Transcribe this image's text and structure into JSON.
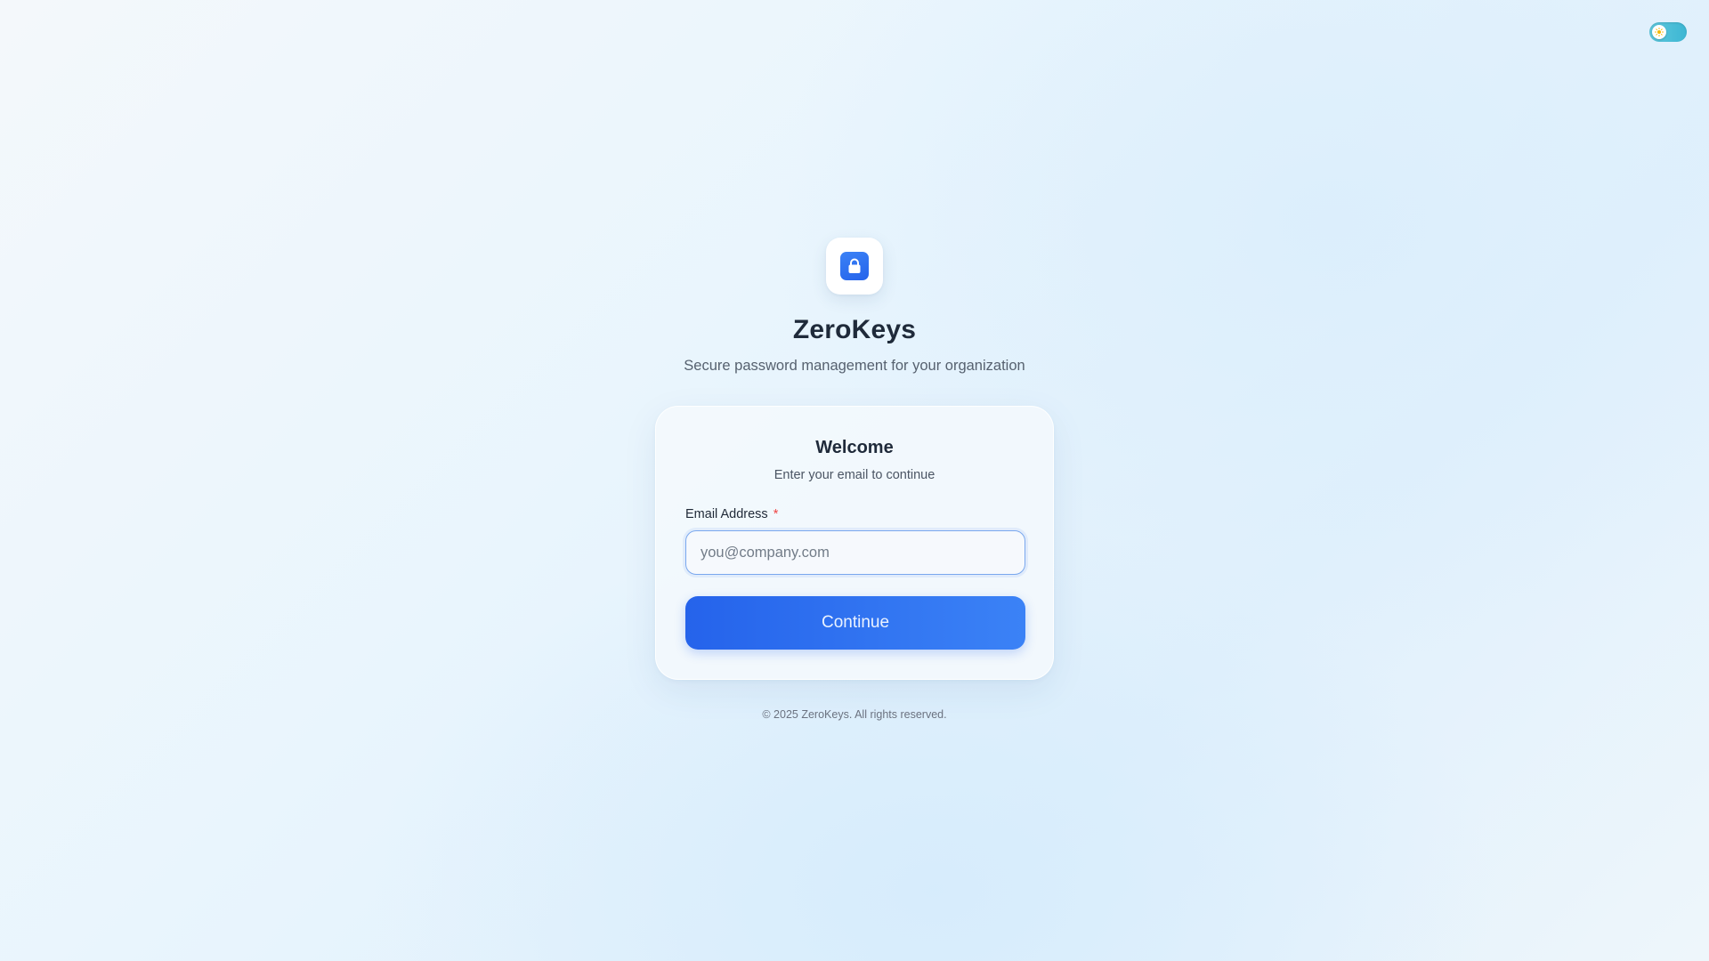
{
  "theme_toggle": {
    "icon": "sun-icon",
    "accent_color": "#3cb6d3"
  },
  "header": {
    "logo_icon": "lock-icon",
    "title": "ZeroKeys",
    "tagline": "Secure password management for your organization"
  },
  "card": {
    "title": "Welcome",
    "subtitle": "Enter your email to continue",
    "email_field": {
      "label": "Email Address",
      "required_mark": "*",
      "value": "",
      "placeholder": "you@company.com"
    },
    "continue_label": "Continue"
  },
  "footer": {
    "copyright": "© 2025 ZeroKeys. All rights reserved."
  },
  "colors": {
    "primary": "#2563eb",
    "primary_light": "#3b82f6",
    "required": "#ef4444"
  }
}
